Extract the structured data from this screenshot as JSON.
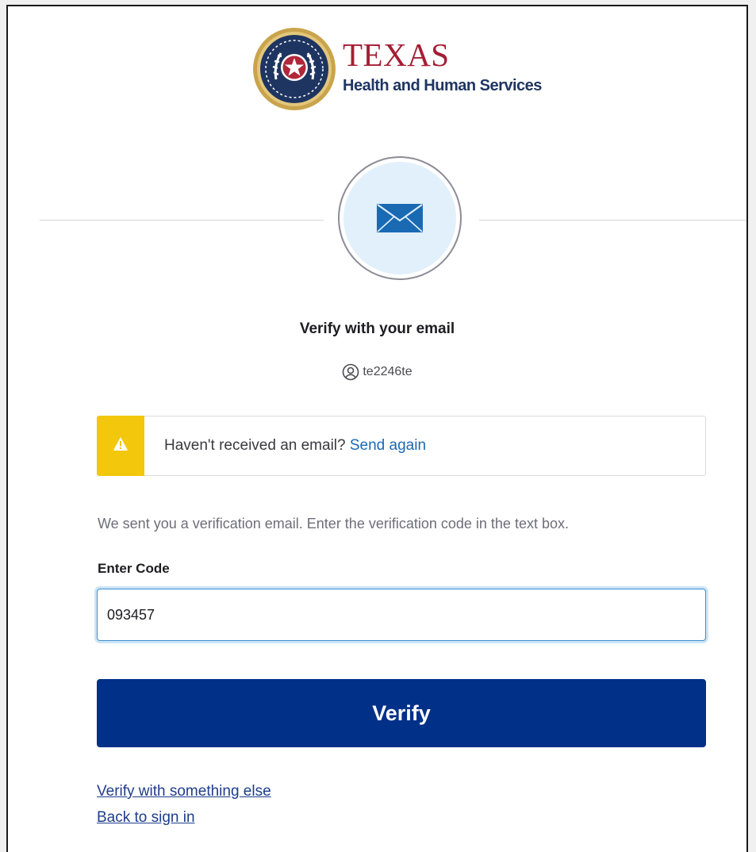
{
  "logo": {
    "title": "TEXAS",
    "subtitle": "Health and Human Services",
    "colors": {
      "title": "#a41e35",
      "subtitle": "#1f3561",
      "seal_ring": "#c9a44c",
      "seal_inner": "#1f3561",
      "star_bg": "#b1273a"
    }
  },
  "factor": {
    "icon": "envelope-icon",
    "color": "#1a6ab3",
    "bg": "#e1f0fb"
  },
  "title": "Verify with your email",
  "identifier": {
    "icon": "user-circle-icon",
    "username": "te2246te"
  },
  "callout": {
    "icon": "warning-icon",
    "text": "Haven't received an email?",
    "link": "Send again",
    "accent": "#f2c70c"
  },
  "instructions": "We sent you a verification email. Enter the verification code in the text box.",
  "code_field": {
    "label": "Enter Code",
    "value": "093457"
  },
  "verify_button": {
    "label": "Verify",
    "color": "#003087"
  },
  "links": {
    "switch": "Verify with something else",
    "back": "Back to sign in"
  }
}
